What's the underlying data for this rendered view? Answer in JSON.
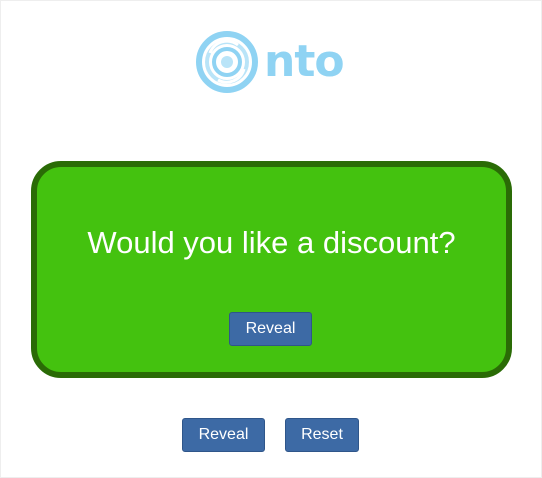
{
  "logo": {
    "text": "nto",
    "icon": "target-circle-icon",
    "color": "#8fd3f3"
  },
  "card": {
    "question": "Would you like a discount?",
    "reveal_label": "Reveal",
    "background_color": "#44c20f",
    "border_color": "#2a6b06"
  },
  "controls": {
    "reveal_label": "Reveal",
    "reset_label": "Reset",
    "button_color": "#3d6aa5"
  }
}
